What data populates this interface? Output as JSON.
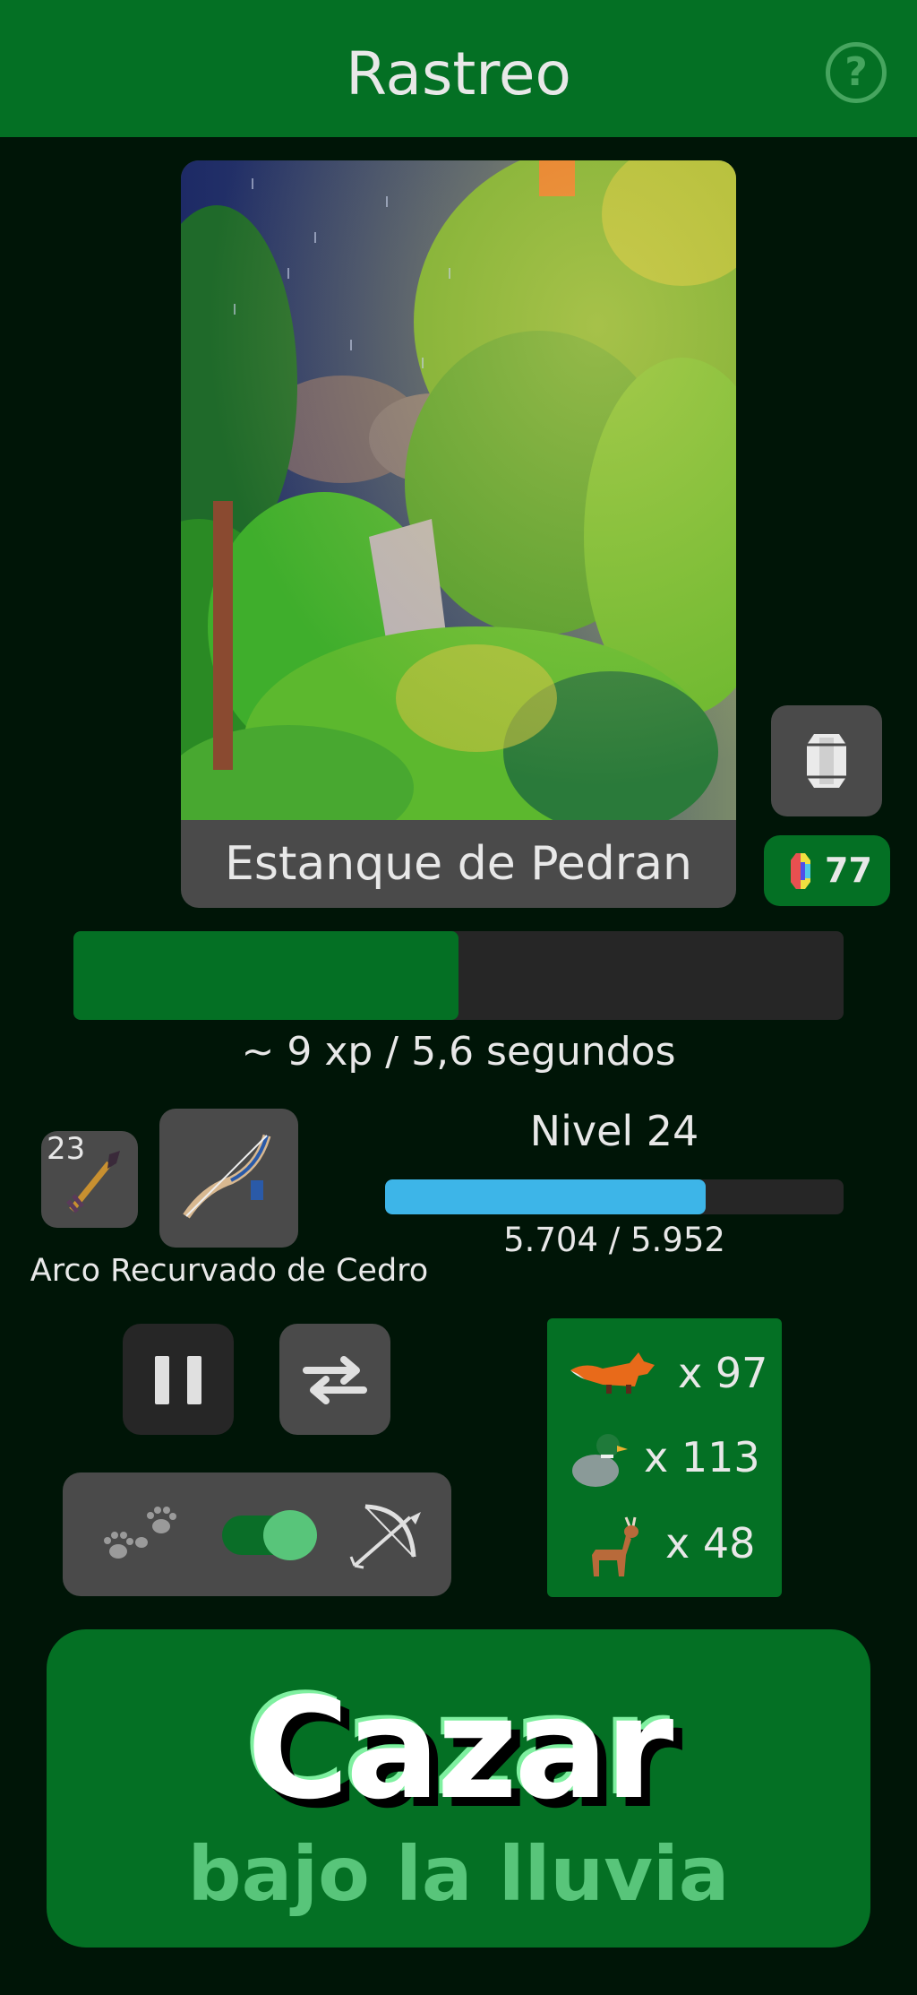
{
  "header": {
    "title": "Rastreo",
    "help_symbol": "?"
  },
  "location": {
    "name": "Estanque de Pedran",
    "weather": "rain"
  },
  "gems": {
    "count": "77"
  },
  "action_progress": {
    "fraction": 0.5,
    "rate_text": "~ 9 xp / 5,6 segundos"
  },
  "equipment": {
    "ammo_count": "23",
    "ammo_icon": "arrow-icon",
    "weapon_icon": "recurve-bow-icon",
    "weapon_name": "Arco Recurvado de Cedro"
  },
  "level": {
    "label": "Nivel 24",
    "xp_text": "5.704 / 5.952",
    "fraction": 0.7
  },
  "controls": {
    "pause_icon": "pause-icon",
    "swap_icon": "swap-arrows-icon"
  },
  "mode": {
    "left_icon": "paw-prints-icon",
    "right_icon": "bow-icon",
    "toggle_on": true
  },
  "catches": [
    {
      "animal": "fox",
      "count": "x 97"
    },
    {
      "animal": "duck",
      "count": "x 113"
    },
    {
      "animal": "deer",
      "count": "x 48"
    }
  ],
  "hunt_button": {
    "title": "Cazar",
    "subtitle": "bajo la lluvia"
  },
  "colors": {
    "background": "#001507",
    "accent_green": "#047024",
    "light_green": "#58c57a",
    "panel_gray": "#4a4a4a",
    "level_blue": "#3db5e8"
  }
}
